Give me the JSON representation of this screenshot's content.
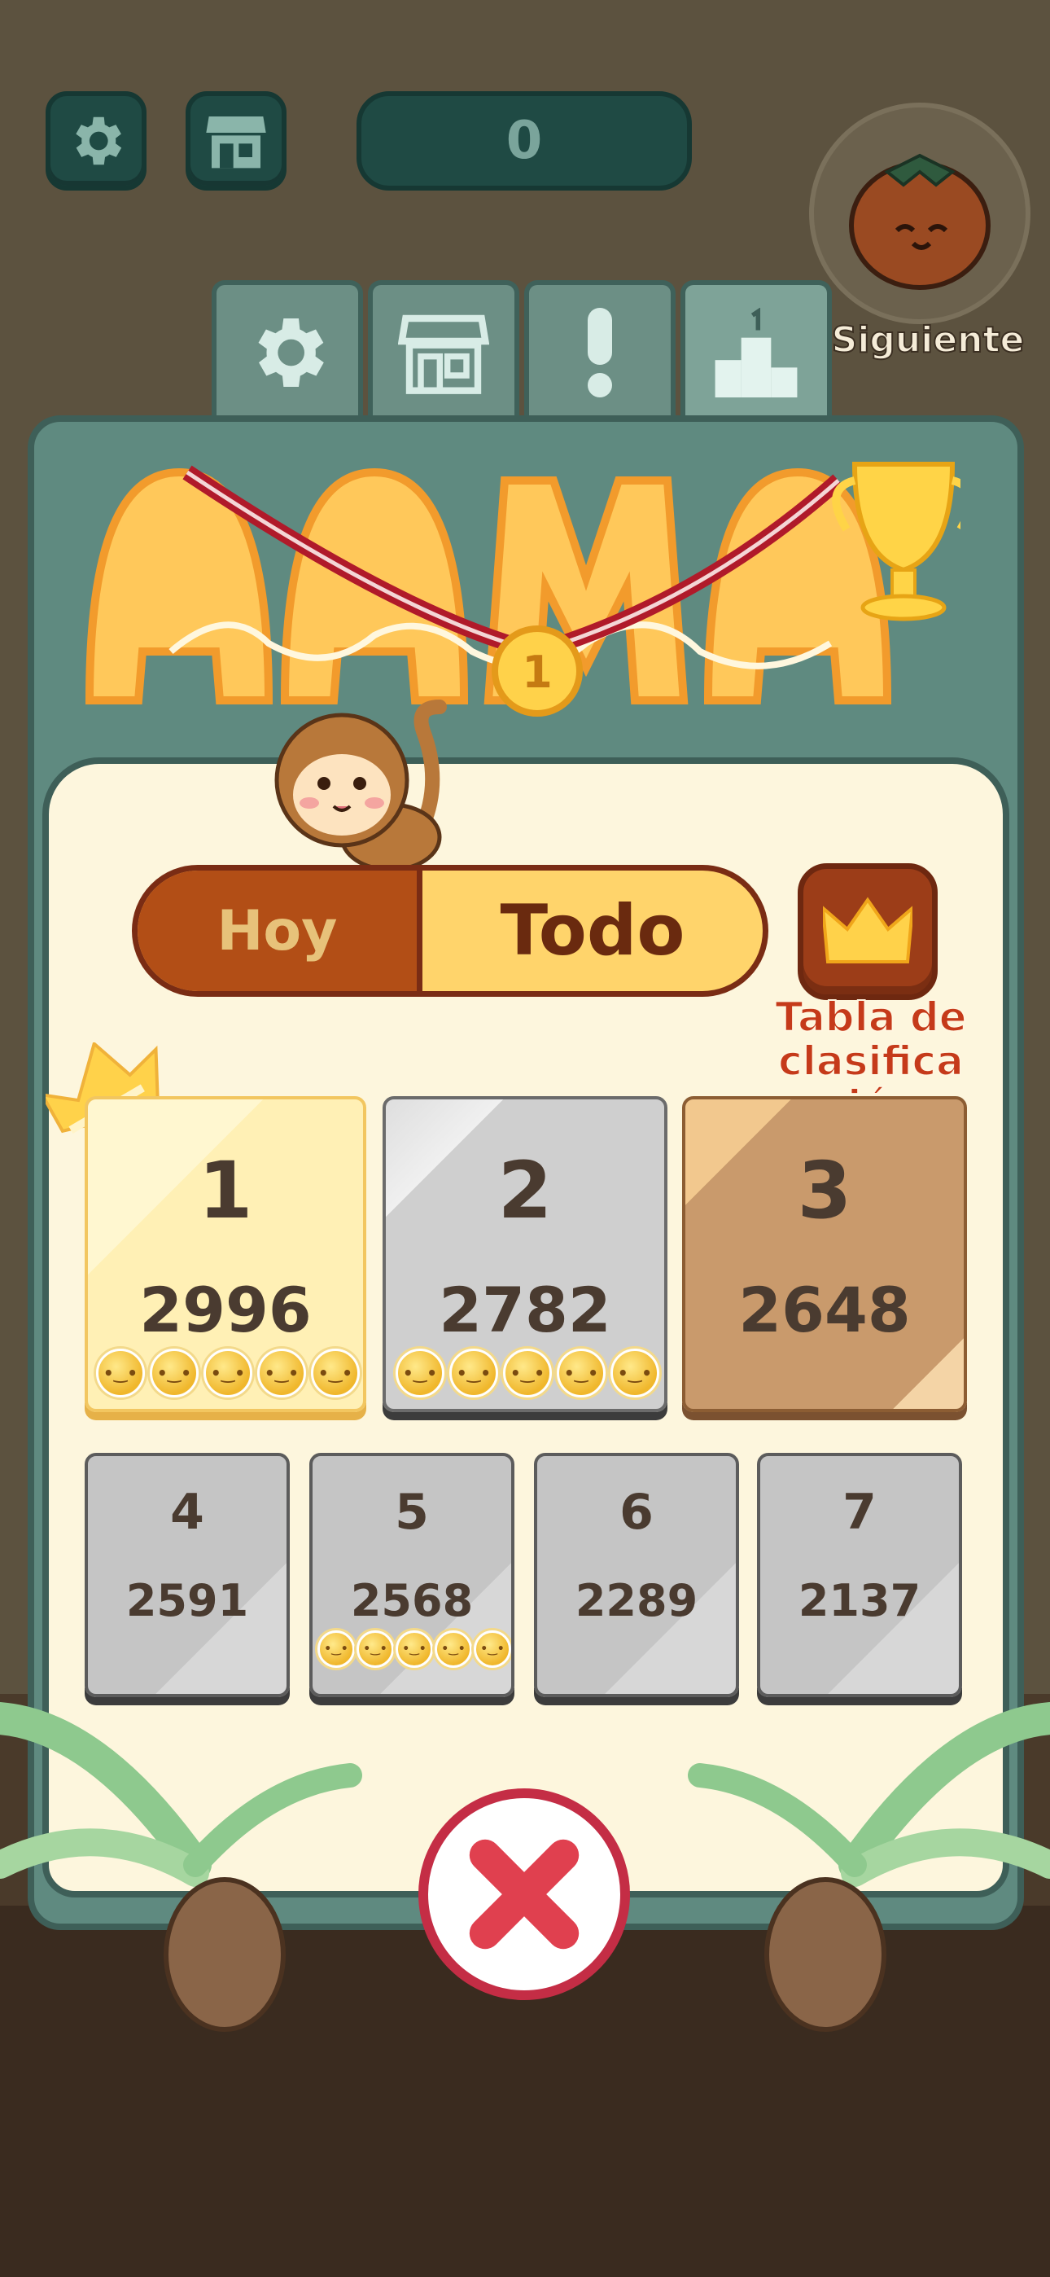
{
  "hud": {
    "score": "0",
    "next_label": "Siguiente"
  },
  "toggle": {
    "left_label": "Hoy",
    "right_label": "Todo"
  },
  "leaderboard_button": {
    "label": "Tabla de clasifica ción"
  },
  "title_art_rank": "1",
  "leaderboard": [
    {
      "rank": "1",
      "score": "2996"
    },
    {
      "rank": "2",
      "score": "2782"
    },
    {
      "rank": "3",
      "score": "2648"
    },
    {
      "rank": "4",
      "score": "2591"
    },
    {
      "rank": "5",
      "score": "2568"
    },
    {
      "rank": "6",
      "score": "2289"
    },
    {
      "rank": "7",
      "score": "2137"
    }
  ],
  "tabs": [
    "gear-icon",
    "shop-icon",
    "exclamation-icon",
    "podium-icon"
  ],
  "colors": {
    "panel": "#5f8a80",
    "inner": "#fdf6dd",
    "toggle_active": "#ffd46b",
    "toggle_inactive": "#b24e16",
    "close_red": "#e0404f"
  }
}
